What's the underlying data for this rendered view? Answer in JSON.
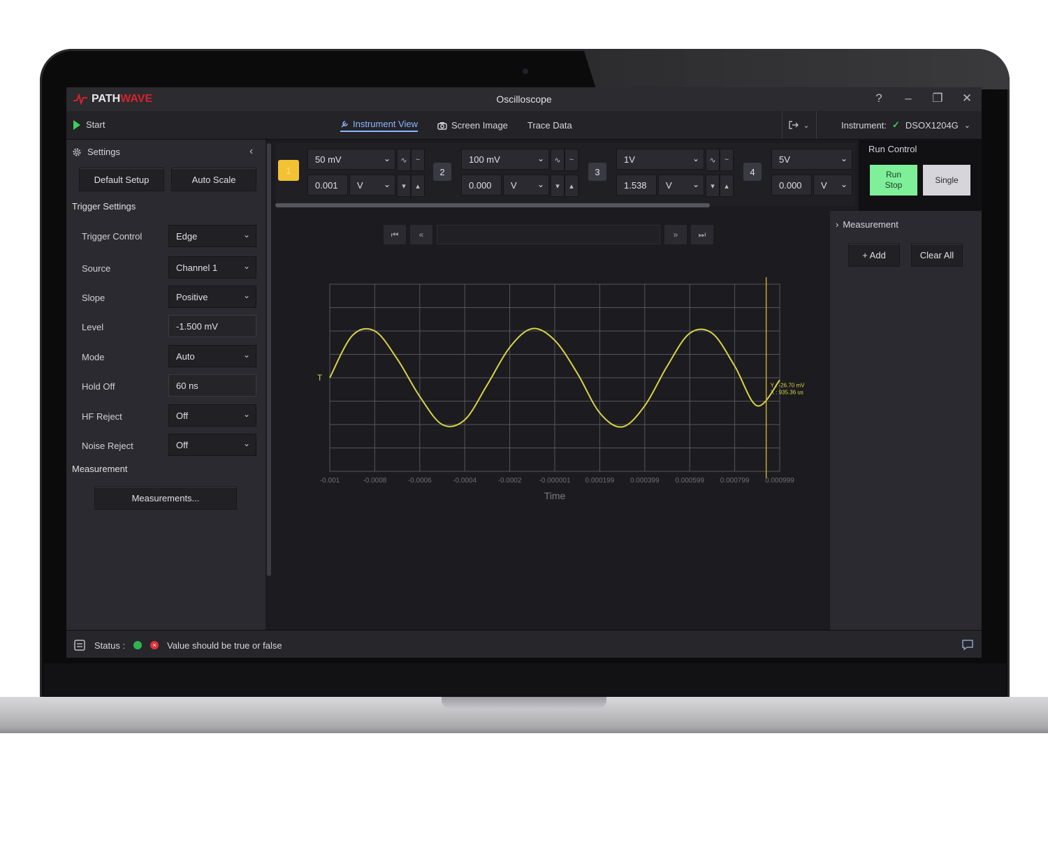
{
  "app": {
    "brand_a": "PATH",
    "brand_b": "WAVE",
    "title": "Oscilloscope",
    "help": "?",
    "minimize": "–",
    "restore": "❐",
    "close": "✕"
  },
  "toolbar": {
    "start": "Start",
    "tabs": [
      {
        "label": "Instrument View",
        "active": true
      },
      {
        "label": "Screen Image",
        "active": false
      },
      {
        "label": "Trace Data",
        "active": false
      }
    ],
    "instrument_label": "Instrument:",
    "instrument_value": "DSOX1204G"
  },
  "settings": {
    "header": "Settings",
    "default_setup": "Default Setup",
    "auto_scale": "Auto Scale",
    "trigger_title": "Trigger Settings",
    "rows": [
      {
        "label": "Trigger Control",
        "value": "Edge",
        "kind": "select"
      },
      {
        "label": "Source",
        "value": "Channel 1",
        "kind": "select"
      },
      {
        "label": "Slope",
        "value": "Positive",
        "kind": "select"
      },
      {
        "label": "Level",
        "value": "-1.500 mV",
        "kind": "field"
      },
      {
        "label": "Mode",
        "value": "Auto",
        "kind": "select"
      },
      {
        "label": "Hold Off",
        "value": "60 ns",
        "kind": "field"
      },
      {
        "label": "HF Reject",
        "value": "Off",
        "kind": "select"
      },
      {
        "label": "Noise Reject",
        "value": "Off",
        "kind": "select"
      }
    ],
    "measurement_title": "Measurement",
    "measurements_button": "Measurements..."
  },
  "channels": [
    {
      "num": "1",
      "scale": "50 mV",
      "offset": "0.001",
      "unit": "V"
    },
    {
      "num": "2",
      "scale": "100 mV",
      "offset": "0.000",
      "unit": "V"
    },
    {
      "num": "3",
      "scale": "1V",
      "offset": "1.538",
      "unit": "V"
    },
    {
      "num": "4",
      "scale": "5V",
      "offset": "0.000",
      "unit": "V"
    }
  ],
  "run_control": {
    "title": "Run Control",
    "run_stop_1": "Run",
    "run_stop_2": "Stop",
    "single": "Single"
  },
  "measurement_panel": {
    "title": "Measurement",
    "add": "+ Add",
    "clear_all": "Clear All"
  },
  "chart_data": {
    "type": "line",
    "xlabel": "Time",
    "x_ticks": [
      "-0.001",
      "-0.0008",
      "-0.0006",
      "-0.0004",
      "-0.0002",
      "-0.000001",
      "0.000199",
      "0.000399",
      "0.000599",
      "0.000799",
      "0.000999"
    ],
    "xlim": [
      -0.001,
      0.001
    ],
    "ylim": [
      -4,
      4
    ],
    "grid": true,
    "series": [
      {
        "color": "#d9d444",
        "x": [
          -0.001,
          -0.0009,
          -0.0008,
          -0.0007,
          -0.0006,
          -0.0005,
          -0.0004,
          -0.0003,
          -0.0002,
          -0.0001,
          0,
          0.0001,
          0.0002,
          0.0003,
          0.0004,
          0.0005,
          0.0006,
          0.0007,
          0.0008,
          0.0009,
          0.001
        ],
        "y": [
          0,
          1.8,
          2.0,
          0.8,
          -0.8,
          -2.0,
          -1.8,
          -0.3,
          1.3,
          2.1,
          1.6,
          0.2,
          -1.5,
          -2.1,
          -1.2,
          0.5,
          1.9,
          1.9,
          0.5,
          -1.2,
          -0.1
        ]
      }
    ],
    "cursor_x": 0.00094,
    "cursor_readout_1": "Y : -26.70 mV",
    "cursor_readout_2": "X : 935.36 us",
    "trigger_marker": "T"
  },
  "status": {
    "label": "Status :",
    "message": "Value should be true or false",
    "error_glyph": "×"
  },
  "colors": {
    "accent": "#8fb6ff",
    "trace": "#d9d444",
    "run": "#7ef09a",
    "brand_red": "#d6232b"
  }
}
